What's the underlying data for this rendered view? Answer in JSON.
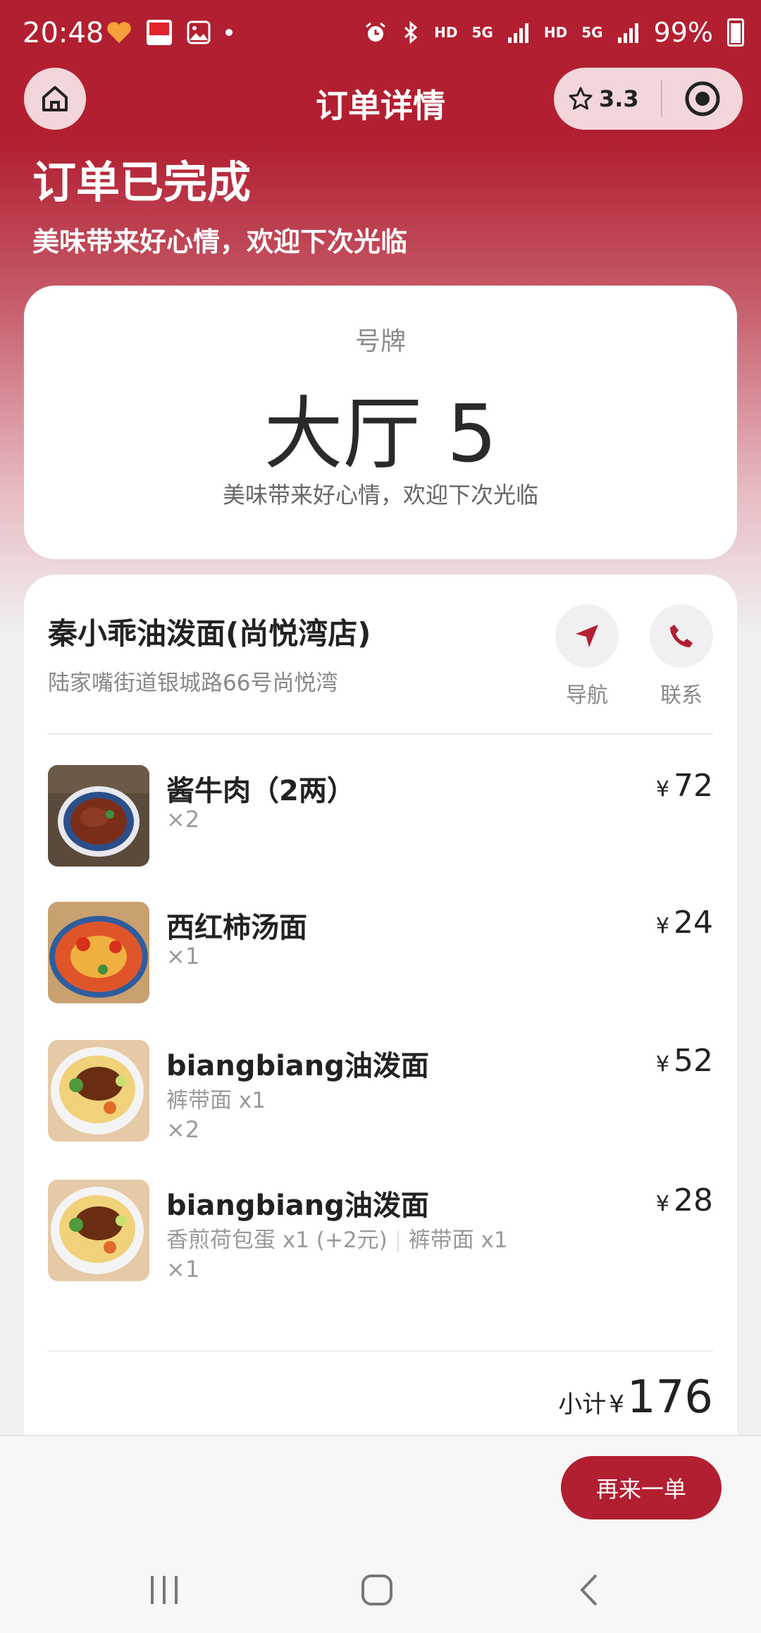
{
  "status_bar": {
    "time": "20:48",
    "battery": "99%",
    "net1": "HD",
    "net2": "5G",
    "net3": "HD",
    "net4": "5G"
  },
  "nav": {
    "title": "订单详情",
    "rating": "3.3"
  },
  "order_status": {
    "title": "订单已完成",
    "subtitle": "美味带来好心情，欢迎下次光临"
  },
  "pickup": {
    "label": "号牌",
    "number": "大厅 5",
    "message": "美味带来好心情，欢迎下次光临"
  },
  "store": {
    "name": "秦小乖油泼面(尚悦湾店)",
    "address": "陆家嘴街道银城路66号尚悦湾",
    "navigate_label": "导航",
    "contact_label": "联系"
  },
  "items": [
    {
      "name": "酱牛肉（2两）",
      "specs": [],
      "qty": "×2",
      "currency": "¥",
      "price": "72"
    },
    {
      "name": "西红柿汤面",
      "specs": [],
      "qty": "×1",
      "currency": "¥",
      "price": "24"
    },
    {
      "name": "biangbiang油泼面",
      "specs": [
        "裤带面 x1"
      ],
      "qty": "×2",
      "currency": "¥",
      "price": "52"
    },
    {
      "name": "biangbiang油泼面",
      "specs": [
        "香煎荷包蛋 x1 (+2元)",
        "裤带面 x1"
      ],
      "qty": "×1",
      "currency": "¥",
      "price": "28"
    }
  ],
  "subtotal": {
    "label": "小计",
    "currency": "¥",
    "amount": "176"
  },
  "actions": {
    "reorder": "再来一单"
  },
  "colors": {
    "brand": "#b21f30",
    "capsule": "#f3d6da"
  }
}
